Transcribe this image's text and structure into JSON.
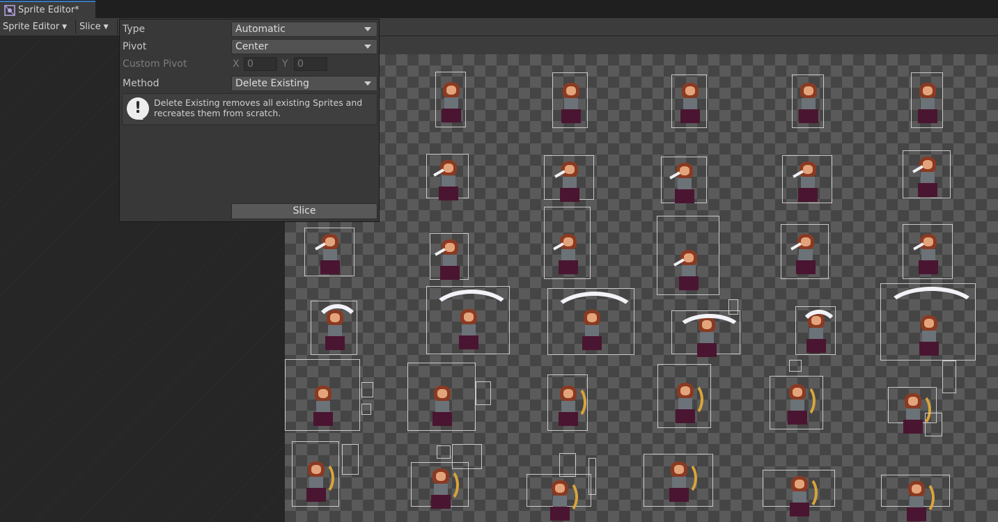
{
  "window": {
    "tab_title": "Sprite Editor*",
    "tab_icon": "sprite-editor-icon"
  },
  "toolbar": {
    "sprite_editor_label": "Sprite Editor",
    "slice_label": "Slice"
  },
  "slice_panel": {
    "type_label": "Type",
    "type_value": "Automatic",
    "pivot_label": "Pivot",
    "pivot_value": "Center",
    "custom_pivot_label": "Custom Pivot",
    "custom_pivot_x_label": "X",
    "custom_pivot_x_value": "0",
    "custom_pivot_y_label": "Y",
    "custom_pivot_y_value": "0",
    "method_label": "Method",
    "method_value": "Delete Existing",
    "help_text": "Delete Existing removes all existing Sprites and recreates them from scratch.",
    "help_icon": "warning-icon",
    "slice_button_label": "Slice"
  },
  "colors": {
    "accent": "#3a79bb",
    "hair": "#8a3a22",
    "skirt": "#4a1530",
    "blade": "#f0f0f5",
    "bow": "#d9a43a"
  }
}
